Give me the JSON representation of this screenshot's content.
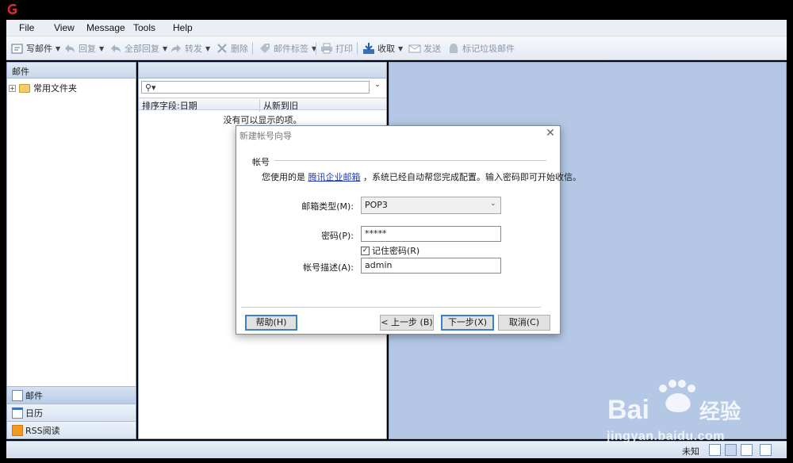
{
  "menubar": [
    "File",
    "View",
    "Message",
    "Tools",
    "Help"
  ],
  "toolbar": {
    "compose": "写邮件",
    "reply": "回复",
    "reply_all": "全部回复",
    "forward": "转发",
    "delete": "删除",
    "tags": "邮件标签",
    "print": "打印",
    "receive": "收取",
    "send": "发送",
    "junk": "标记垃圾邮件"
  },
  "left_pane": {
    "header": "邮件",
    "folder": "常用文件夹",
    "nav": [
      "邮件",
      "日历",
      "RSS阅读"
    ]
  },
  "list_pane": {
    "sort_field": "排序字段:日期",
    "sort_order": "从新到旧",
    "empty": "没有可以显示的项。"
  },
  "dialog": {
    "title": "新建帐号向导",
    "group": "帐号",
    "intro_before": "您使用的是 ",
    "intro_link": "腾讯企业邮箱",
    "intro_after": " ，系统已经自动帮您完成配置。输入密码即可开始收信。",
    "type_label": "邮箱类型(M):",
    "type_value": "POP3",
    "password_label": "密码(P):",
    "password_value": "*****",
    "remember_label": "记住密码(R)",
    "remember_checked": true,
    "desc_label": "帐号描述(A):",
    "desc_value": "admin",
    "buttons": {
      "help": "帮助(H)",
      "back": "< 上一步 (B)",
      "next": "下一步(X)",
      "cancel": "取消(C)"
    }
  },
  "status": {
    "text": "未知"
  },
  "watermark": {
    "logo": "Bai du 经验",
    "url": "jingyan.baidu.com"
  },
  "colors": {
    "reading_pane": "#b4c8e6",
    "accent": "#3c7fd0",
    "link": "#1a39c7"
  }
}
